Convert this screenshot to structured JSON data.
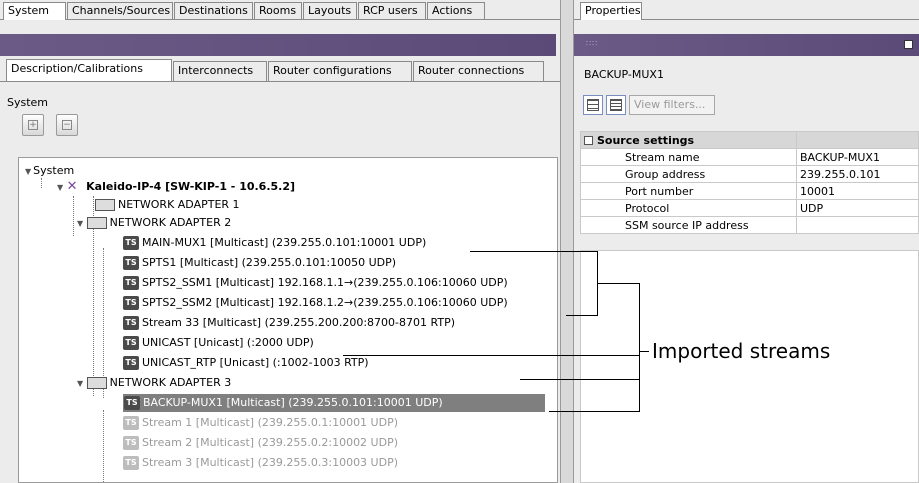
{
  "left_tabs": [
    {
      "label": "System",
      "active": true
    },
    {
      "label": "Channels/Sources",
      "active": false
    },
    {
      "label": "Destinations",
      "active": false
    },
    {
      "label": "Rooms",
      "active": false
    },
    {
      "label": "Layouts",
      "active": false
    },
    {
      "label": "RCP users",
      "active": false
    },
    {
      "label": "Actions",
      "active": false
    }
  ],
  "sub_tabs": [
    {
      "label": "Description/Calibrations",
      "active": true
    },
    {
      "label": "Interconnects",
      "active": false
    },
    {
      "label": "Router configurations",
      "active": false
    },
    {
      "label": "Router connections",
      "active": false
    }
  ],
  "system_label": "System",
  "tree": {
    "root": "System",
    "device": "Kaleido-IP-4 [SW-KIP-1 - 10.6.5.2]",
    "adapter1": "NETWORK ADAPTER 1",
    "adapter2": "NETWORK ADAPTER 2",
    "adapter3": "NETWORK ADAPTER 3",
    "streams2": [
      "MAIN-MUX1 [Multicast] (239.255.0.101:10001 UDP)",
      "SPTS1 [Multicast] (239.255.0.101:10050 UDP)",
      "SPTS2_SSM1 [Multicast] 192.168.1.1→(239.255.0.106:10060 UDP)",
      "SPTS2_SSM2 [Multicast] 192.168.1.2→(239.255.0.106:10060 UDP)",
      "Stream 33 [Multicast] (239.255.200.200:8700-8701 RTP)",
      "UNICAST [Unicast] (:2000 UDP)",
      "UNICAST_RTP [Unicast] (:1002-1003 RTP)"
    ],
    "streams3": [
      "BACKUP-MUX1 [Multicast] (239.255.0.101:10001 UDP)",
      "Stream 1 [Multicast] (239.255.0.1:10001 UDP)",
      "Stream 2 [Multicast] (239.255.0.2:10002 UDP)",
      "Stream 3 [Multicast] (239.255.0.3:10003 UDP)"
    ],
    "ts_badge": "TS"
  },
  "properties": {
    "tab_label": "Properties",
    "title": "BACKUP-MUX1",
    "view_filters": "View filters...",
    "section": "Source settings",
    "rows": [
      {
        "name": "Stream name",
        "value": "BACKUP-MUX1"
      },
      {
        "name": "Group address",
        "value": "239.255.0.101"
      },
      {
        "name": "Port number",
        "value": "10001"
      },
      {
        "name": "Protocol",
        "value": "UDP"
      },
      {
        "name": "SSM source IP address",
        "value": ""
      }
    ]
  },
  "annotation": "Imported streams",
  "colors": {
    "title_bar": "#6c5a86",
    "selected": "#7f7f7f"
  }
}
